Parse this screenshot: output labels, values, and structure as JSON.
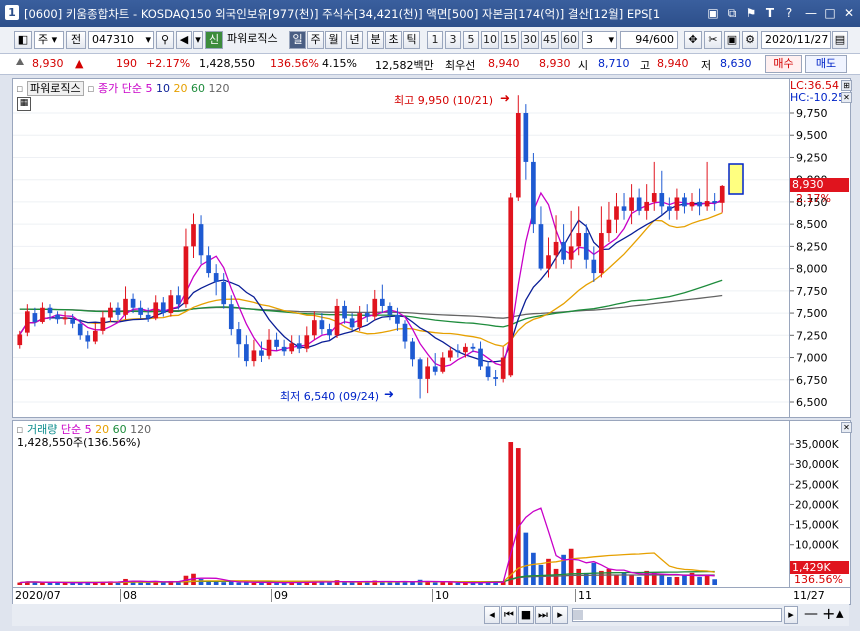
{
  "window": {
    "app_number": "1",
    "title": "[0600] 키움종합차트 - KOSDAQ150 외국인보유[977(천)] 주식수[34,421(천)] 액면[500] 자본금[174(억)] 결산[12월] EPS[1",
    "controls": [
      "▣",
      "⧉",
      "⚑",
      "T",
      "?",
      "—",
      "□",
      "✕"
    ]
  },
  "toolbar": {
    "market_label": "주",
    "prev_label": "전",
    "code": "047310",
    "new_label": "신",
    "stock_name": "파워로직스",
    "periods": [
      "일",
      "주",
      "월",
      "년",
      "분",
      "초",
      "틱"
    ],
    "active_period": "일",
    "intervals": [
      "1",
      "3",
      "5",
      "10",
      "15",
      "30",
      "45",
      "60"
    ],
    "interval_value": "3",
    "count": "94/600",
    "date": "2020/11/27"
  },
  "quote": {
    "price": "8,930",
    "arrow": "▲",
    "change": "190",
    "change_pct": "+2.17%",
    "volume": "1,428,550",
    "volume_ratio": "136.56%",
    "turnover": "4.15%",
    "amount": "12,582백만",
    "trade_label": "최우선",
    "best_ask": "8,940",
    "best_bid": "8,930",
    "open_label": "시",
    "open": "8,710",
    "high_label": "고",
    "high": "8,940",
    "low_label": "저",
    "low": "8,630",
    "buy_button": "매수",
    "sell_button": "매도"
  },
  "price_pane": {
    "legend_name": "파워로직스",
    "legend_ma_label": "종가 단순",
    "ma_periods": [
      "5",
      "10",
      "20",
      "60",
      "120"
    ],
    "high_annotation": "최고 9,950 (10/21)",
    "low_annotation": "최저 6,540 (09/24)",
    "lc": "LC:36.54",
    "hc": "HC:-10.25",
    "current_price_tag": "8,930",
    "current_pct_tag": "2.17%",
    "y_ticks": [
      "9,750",
      "9,500",
      "9,250",
      "9,000",
      "8,750",
      "8,500",
      "8,250",
      "8,000",
      "7,750",
      "7,500",
      "7,250",
      "7,000",
      "6,750",
      "6,500"
    ]
  },
  "volume_pane": {
    "legend_name": "거래량",
    "legend_ma_label": "단순",
    "ma_periods": [
      "5",
      "20",
      "60",
      "120"
    ],
    "current_volume_text": "1,428,550주(136.56%)",
    "current_volume_tag": "1,429K",
    "current_pct_tag": "136.56%",
    "y_ticks": [
      "35,000K",
      "30,000K",
      "25,000K",
      "20,000K",
      "15,000K",
      "10,000K",
      "5,000K"
    ]
  },
  "date_axis": {
    "labels": [
      "2020/07",
      "08",
      "09",
      "10",
      "11"
    ],
    "end_label": "11/27"
  },
  "colors": {
    "up": "#e0141e",
    "down": "#1e5ad2",
    "ma5": "#c800c8",
    "ma10": "#0a1e96",
    "ma20": "#e6a000",
    "ma60": "#1e8c3c",
    "ma120": "#646464"
  },
  "chart_data": {
    "type": "candlestick",
    "x_range": [
      "2020/07",
      "2020/11/27"
    ],
    "ylim": [
      6500,
      9750
    ],
    "highest": {
      "value": 9950,
      "date": "10/21"
    },
    "lowest": {
      "value": 6540,
      "date": "09/24"
    },
    "last_close": 8930,
    "candles": [
      [
        7140,
        7260,
        7100,
        7300
      ],
      [
        7280,
        7520,
        7240,
        7600
      ],
      [
        7500,
        7400,
        7350,
        7560
      ],
      [
        7400,
        7560,
        7380,
        7620
      ],
      [
        7560,
        7500,
        7420,
        7600
      ],
      [
        7480,
        7430,
        7380,
        7520
      ],
      [
        7430,
        7450,
        7370,
        7520
      ],
      [
        7430,
        7380,
        7330,
        7490
      ],
      [
        7380,
        7250,
        7200,
        7430
      ],
      [
        7250,
        7180,
        7100,
        7300
      ],
      [
        7180,
        7300,
        7150,
        7390
      ],
      [
        7300,
        7450,
        7260,
        7520
      ],
      [
        7450,
        7560,
        7400,
        7620
      ],
      [
        7560,
        7480,
        7420,
        7620
      ],
      [
        7480,
        7660,
        7430,
        7800
      ],
      [
        7660,
        7560,
        7500,
        7720
      ],
      [
        7560,
        7480,
        7440,
        7640
      ],
      [
        7480,
        7440,
        7400,
        7560
      ],
      [
        7440,
        7620,
        7420,
        7700
      ],
      [
        7620,
        7500,
        7460,
        7680
      ],
      [
        7500,
        7700,
        7460,
        7760
      ],
      [
        7700,
        7600,
        7540,
        7800
      ],
      [
        7600,
        8250,
        7560,
        8450
      ],
      [
        8250,
        8500,
        8120,
        8620
      ],
      [
        8500,
        8150,
        8050,
        8600
      ],
      [
        8150,
        7950,
        7900,
        8250
      ],
      [
        7950,
        7850,
        7700,
        8050
      ],
      [
        7850,
        7600,
        7550,
        7950
      ],
      [
        7600,
        7320,
        7250,
        7700
      ],
      [
        7320,
        7150,
        7000,
        7400
      ],
      [
        7150,
        6960,
        6900,
        7250
      ],
      [
        6960,
        7080,
        6900,
        7200
      ],
      [
        7080,
        7020,
        6950,
        7180
      ],
      [
        7020,
        7200,
        6980,
        7320
      ],
      [
        7200,
        7120,
        7080,
        7280
      ],
      [
        7120,
        7070,
        7020,
        7200
      ],
      [
        7070,
        7160,
        7040,
        7250
      ],
      [
        7160,
        7100,
        7050,
        7250
      ],
      [
        7100,
        7250,
        7060,
        7350
      ],
      [
        7250,
        7420,
        7200,
        7520
      ],
      [
        7420,
        7320,
        7260,
        7500
      ],
      [
        7320,
        7250,
        7200,
        7380
      ],
      [
        7250,
        7580,
        7220,
        7660
      ],
      [
        7580,
        7440,
        7380,
        7640
      ],
      [
        7440,
        7340,
        7300,
        7500
      ],
      [
        7340,
        7500,
        7300,
        7580
      ],
      [
        7500,
        7460,
        7400,
        7600
      ],
      [
        7460,
        7660,
        7420,
        7760
      ],
      [
        7660,
        7580,
        7500,
        7820
      ],
      [
        7580,
        7480,
        7420,
        7620
      ],
      [
        7480,
        7380,
        7300,
        7560
      ],
      [
        7380,
        7180,
        7100,
        7420
      ],
      [
        7180,
        6980,
        6900,
        7220
      ],
      [
        6980,
        6760,
        6540,
        7000
      ],
      [
        6760,
        6900,
        6600,
        7000
      ],
      [
        6900,
        6840,
        6800,
        7050
      ],
      [
        6840,
        7000,
        6820,
        7060
      ],
      [
        7000,
        7080,
        6960,
        7120
      ],
      [
        7080,
        7060,
        7000,
        7150
      ],
      [
        7060,
        7120,
        7000,
        7160
      ],
      [
        7120,
        7100,
        7060,
        7160
      ],
      [
        7100,
        6900,
        6860,
        7180
      ],
      [
        6900,
        6780,
        6740,
        6960
      ],
      [
        6780,
        6760,
        6680,
        6860
      ],
      [
        6760,
        7000,
        6720,
        7120
      ],
      [
        6800,
        8800,
        6780,
        8850
      ],
      [
        8800,
        9750,
        8760,
        9950
      ],
      [
        9750,
        9200,
        9000,
        9850
      ],
      [
        9200,
        8500,
        8400,
        9300
      ],
      [
        8500,
        8000,
        7980,
        8700
      ],
      [
        8000,
        8150,
        7900,
        8350
      ],
      [
        8150,
        8300,
        8000,
        8600
      ],
      [
        8300,
        8100,
        8050,
        8500
      ],
      [
        8100,
        8250,
        8000,
        8650
      ],
      [
        8250,
        8400,
        8150,
        8700
      ],
      [
        8400,
        8100,
        8000,
        8500
      ],
      [
        8100,
        7950,
        7850,
        8250
      ],
      [
        7950,
        8400,
        7900,
        8700
      ],
      [
        8400,
        8550,
        8300,
        8750
      ],
      [
        8550,
        8700,
        8400,
        8850
      ],
      [
        8700,
        8650,
        8550,
        8850
      ],
      [
        8650,
        8800,
        8500,
        8950
      ],
      [
        8800,
        8650,
        8600,
        8900
      ],
      [
        8650,
        8750,
        8550,
        8950
      ],
      [
        8750,
        8850,
        8650,
        9200
      ],
      [
        8850,
        8700,
        8600,
        9100
      ],
      [
        8700,
        8650,
        8550,
        8800
      ],
      [
        8650,
        8800,
        8550,
        8900
      ],
      [
        8800,
        8700,
        8620,
        8850
      ],
      [
        8700,
        8750,
        8650,
        8850
      ],
      [
        8750,
        8700,
        8600,
        8900
      ],
      [
        8700,
        8760,
        8650,
        9200
      ],
      [
        8760,
        8740,
        8650,
        8850
      ],
      [
        8740,
        8930,
        8630,
        8940
      ]
    ],
    "volumes_k": [
      600,
      900,
      700,
      600,
      500,
      700,
      600,
      500,
      600,
      700,
      600,
      800,
      900,
      700,
      1500,
      900,
      700,
      600,
      900,
      800,
      1000,
      900,
      2300,
      2800,
      1500,
      900,
      800,
      700,
      900,
      600,
      700,
      500,
      600,
      700,
      600,
      500,
      600,
      700,
      800,
      900,
      700,
      600,
      1200,
      800,
      700,
      900,
      700,
      1100,
      900,
      700,
      800,
      900,
      700,
      1300,
      800,
      600,
      700,
      600,
      500,
      600,
      500,
      700,
      800,
      600,
      900,
      35500,
      34000,
      13000,
      8000,
      5000,
      6500,
      4000,
      7500,
      9000,
      4000,
      3000,
      5500,
      3500,
      4000,
      2500,
      3000,
      2500,
      2000,
      3500,
      3000,
      2500,
      2000,
      2000,
      2500,
      3000,
      2000,
      2500,
      1429
    ]
  }
}
